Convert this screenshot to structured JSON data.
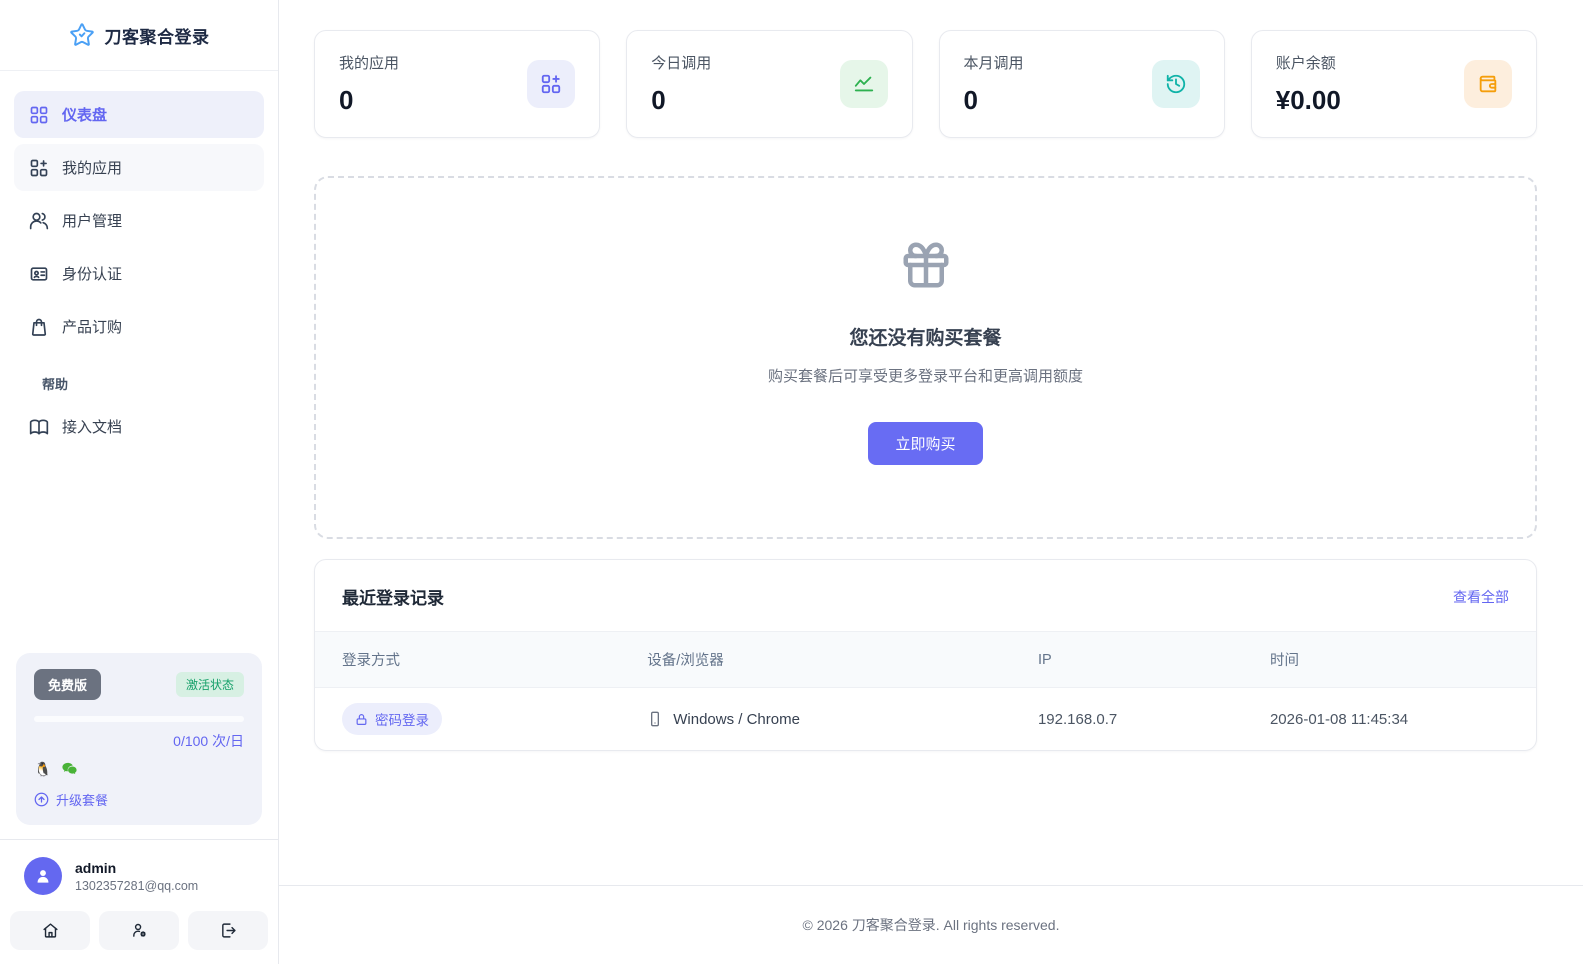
{
  "app": {
    "title": "刀客聚合登录",
    "footer_text": "© 2026 刀客聚合登录. All rights reserved."
  },
  "sidebar": {
    "items": [
      {
        "label": "仪表盘"
      },
      {
        "label": "我的应用"
      },
      {
        "label": "用户管理"
      },
      {
        "label": "身份认证"
      },
      {
        "label": "产品订购"
      }
    ],
    "help_section_label": "帮助",
    "help_items": [
      {
        "label": "接入文档"
      }
    ],
    "plan": {
      "name": "免费版",
      "status": "激活状态",
      "quota": "0/100 次/日",
      "upgrade_label": "升级套餐"
    },
    "user": {
      "name": "admin",
      "email": "1302357281@qq.com"
    }
  },
  "stats": {
    "cards": [
      {
        "label": "我的应用",
        "value": "0"
      },
      {
        "label": "今日调用",
        "value": "0"
      },
      {
        "label": "本月调用",
        "value": "0"
      },
      {
        "label": "账户余额",
        "value": "¥0.00"
      }
    ]
  },
  "empty_state": {
    "title": "您还没有购买套餐",
    "subtitle": "购买套餐后可享受更多登录平台和更高调用额度",
    "button_label": "立即购买"
  },
  "recent_logins": {
    "title": "最近登录记录",
    "view_all_label": "查看全部",
    "columns": [
      "登录方式",
      "设备/浏览器",
      "IP",
      "时间"
    ],
    "rows": [
      {
        "method": "密码登录",
        "device": "Windows / Chrome",
        "ip": "192.168.0.7",
        "time": "2026-01-08 11:45:34"
      }
    ]
  },
  "colors": {
    "primary": "#6366f1",
    "green": "#2eb150",
    "teal": "#10b3a8",
    "orange": "#f59e0b",
    "status_green": "#16a06a"
  }
}
